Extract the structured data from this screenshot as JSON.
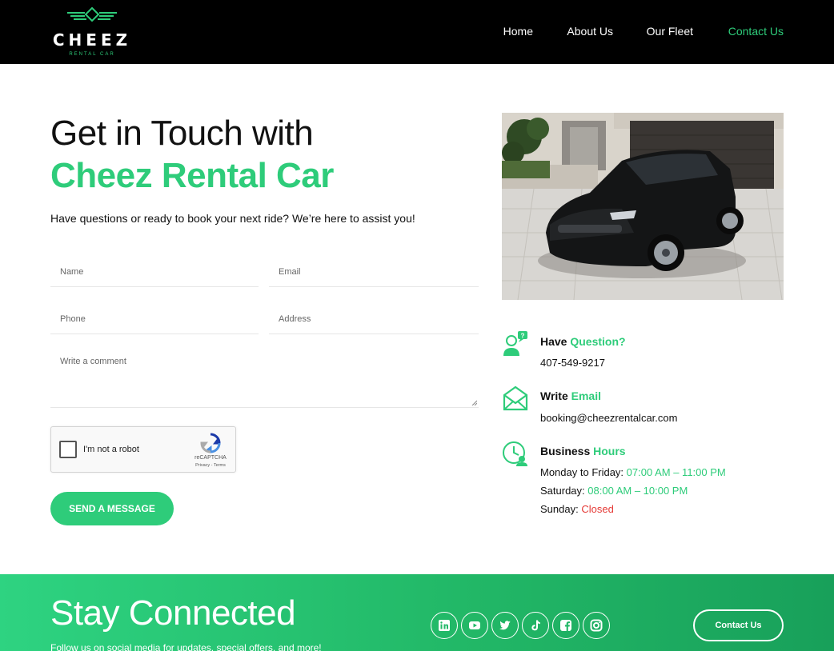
{
  "brand": {
    "name": "CHEEZ",
    "tagline": "RENTAL CAR"
  },
  "nav": [
    {
      "label": "Home",
      "active": false
    },
    {
      "label": "About Us",
      "active": false
    },
    {
      "label": "Our Fleet",
      "active": false
    },
    {
      "label": "Contact Us",
      "active": true
    }
  ],
  "hero": {
    "title_line1": "Get in Touch with",
    "title_line2": "Cheez Rental Car",
    "intro": "Have questions or ready to book your next ride? We’re here to assist you!"
  },
  "form": {
    "name_placeholder": "Name",
    "email_placeholder": "Email",
    "phone_placeholder": "Phone",
    "address_placeholder": "Address",
    "comment_placeholder": "Write a comment",
    "captcha_label": "I'm not a robot",
    "captcha_brand": "reCAPTCHA",
    "captcha_terms": "Privacy - Terms",
    "submit_label": "SEND A MESSAGE"
  },
  "info": {
    "question": {
      "title_plain": "Have",
      "title_accent": "Question?",
      "value": "407-549-9217",
      "icon": "support-agent-icon"
    },
    "email": {
      "title_plain": "Write",
      "title_accent": "Email",
      "value": "booking@cheezrentalcar.com",
      "icon": "mail-icon"
    },
    "hours": {
      "title_plain": "Business",
      "title_accent": "Hours",
      "icon": "clock-icon",
      "weekday_label": "Monday to Friday:",
      "weekday_value": "07:00 AM – 11:00 PM",
      "saturday_label": "Saturday:",
      "saturday_value": "08:00 AM – 10:00 PM",
      "sunday_label": "Sunday:",
      "sunday_value": "Closed"
    }
  },
  "footer": {
    "title": "Stay Connected",
    "subtitle": "Follow us on social media for updates, special offers, and more!",
    "social": [
      "linkedin-icon",
      "youtube-icon",
      "twitter-icon",
      "tiktok-icon",
      "facebook-icon",
      "instagram-icon"
    ],
    "contact_label": "Contact Us"
  },
  "colors": {
    "accent": "#2ecc7a",
    "header_bg": "#000000",
    "closed": "#e53935"
  }
}
